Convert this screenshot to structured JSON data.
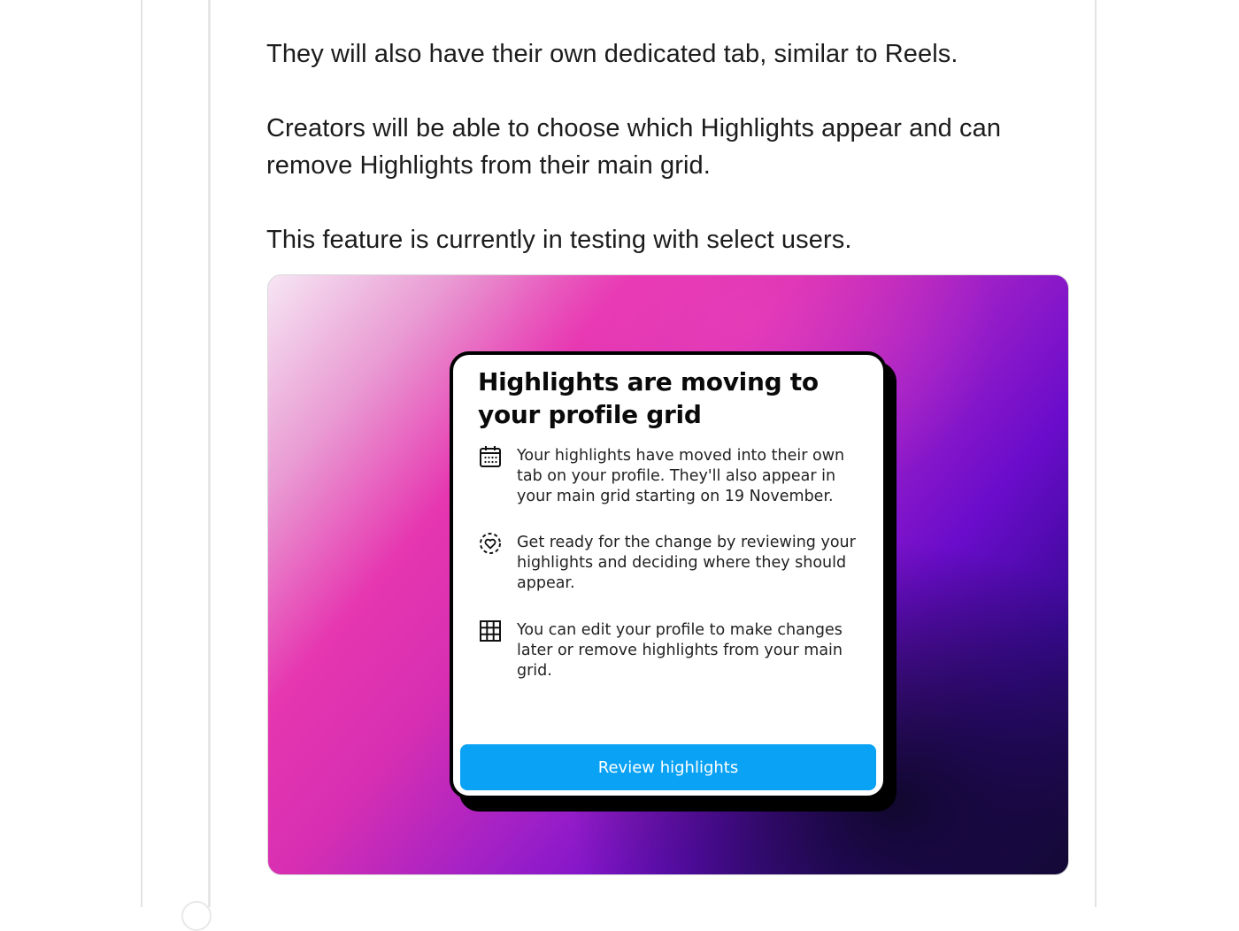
{
  "post": {
    "paragraphs": [
      "They will also have their own dedicated tab, similar to Reels.",
      "Creators will be able to choose which Highlights appear and can remove Highlights from their main grid.",
      "This feature is currently in testing with select users."
    ]
  },
  "media": {
    "card": {
      "title": "Highlights are moving to your profile grid",
      "items": [
        {
          "icon": "calendar-icon",
          "text": "Your highlights have moved into their own tab on your profile. They'll also appear in your main grid starting on 19 November."
        },
        {
          "icon": "heart-circle-icon",
          "text": "Get ready for the change by reviewing your highlights and deciding where they should appear."
        },
        {
          "icon": "grid-icon",
          "text": "You can edit your profile to make changes later or remove highlights from your main grid."
        }
      ],
      "button_label": "Review highlights"
    }
  },
  "colors": {
    "button": "#0aa2f5",
    "gradient_pink": "#e636b0",
    "gradient_purple": "#6a0ccb",
    "gradient_dark": "#150a3a"
  }
}
